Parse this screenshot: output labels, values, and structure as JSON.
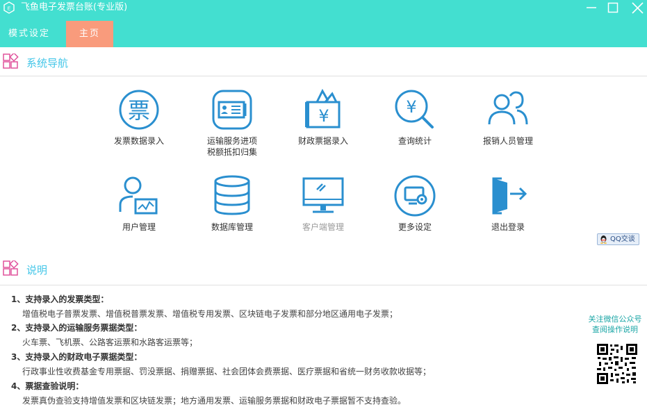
{
  "window": {
    "title": "飞鱼电子发票台账(专业版)",
    "logo_icon": "feiyu-logo-icon",
    "minimize_icon": "minimize-icon",
    "maximize_icon": "maximize-icon",
    "close_icon": "close-icon"
  },
  "menu": {
    "mode_settings": "模式设定",
    "home": "主页"
  },
  "colors": {
    "accent": "#43dfd0",
    "active_tab": "#f99b7c",
    "section_title": "#43c6e8",
    "icon_stroke": "#2a8fcf"
  },
  "nav": {
    "section_title": "系统导航",
    "section_icon": "grid-icon",
    "items": [
      {
        "label": "发票数据录入",
        "icon": "invoice-icon"
      },
      {
        "label": "运输服务进项\n税额抵扣归集",
        "icon": "id-card-icon"
      },
      {
        "label": "财政票据录入",
        "icon": "yuan-ticket-icon"
      },
      {
        "label": "查询统计",
        "icon": "yuan-search-icon"
      },
      {
        "label": "报销人员管理",
        "icon": "users-icon"
      },
      {
        "label": "用户管理",
        "icon": "user-chart-icon"
      },
      {
        "label": "数据库管理",
        "icon": "database-icon"
      },
      {
        "label": "客户端管理",
        "icon": "monitor-icon"
      },
      {
        "label": "更多设定",
        "icon": "settings-screen-icon"
      },
      {
        "label": "退出登录",
        "icon": "exit-door-icon"
      }
    ]
  },
  "qq": {
    "label": "QQ交谈",
    "icon": "qq-penguin-icon"
  },
  "description": {
    "section_title": "说明",
    "section_icon": "grid-icon",
    "items": [
      {
        "title": "1、支持录入的发票类型：",
        "text": "增值税电子普票发票、增值税普票发票、增值税专用发票、区块链电子发票和部分地区通用电子发票；"
      },
      {
        "title": "2、支持录入的运输服务票据类型：",
        "text": "火车票、飞机票、公路客运票和水路客运票等；"
      },
      {
        "title": "3、支持录入的财政电子票据类型：",
        "text": "行政事业性收费基金专用票据、罚没票据、捐赠票据、社会团体会费票据、医疗票据和省统一财务收款收据等；"
      },
      {
        "title": "4、票据查验说明：",
        "text": "发票真伪查验支持增值发票和区块链发票；地方通用发票、运输服务票据和财政电子票据暂不支持查验。"
      }
    ]
  },
  "wechat": {
    "line1": "关注微信公众号",
    "line2": "查阅操作说明",
    "qr_icon": "qr-code-icon"
  }
}
